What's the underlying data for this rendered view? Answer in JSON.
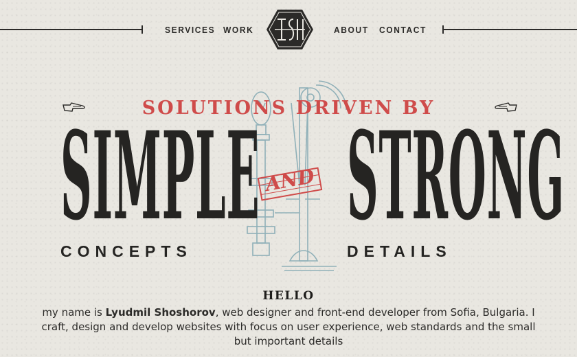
{
  "nav": {
    "items": [
      {
        "label": "SERVICES"
      },
      {
        "label": "WORK"
      },
      {
        "label": "ABOUT"
      },
      {
        "label": "CONTACT"
      }
    ],
    "logo_text": "LSH"
  },
  "hero": {
    "top_line": "SOLUTIONS DRIVEN BY",
    "left_big": "SIMPLE",
    "right_big": "STRONG",
    "left_sub": "CONCEPTS",
    "right_sub": "DETAILS",
    "connector": "AND"
  },
  "intro": {
    "heading": "HELLO",
    "prefix": "my name is ",
    "name": "Lyudmil Shoshorov",
    "rest": ", web designer and front-end developer from Sofia, Bulgaria. I craft, design and develop websites with focus on user experience, web standards and the small but important details"
  },
  "colors": {
    "background": "#e9e7e1",
    "ink": "#252422",
    "accent_red": "#cf4b4a",
    "engraving_blue": "#8fb0b8"
  }
}
